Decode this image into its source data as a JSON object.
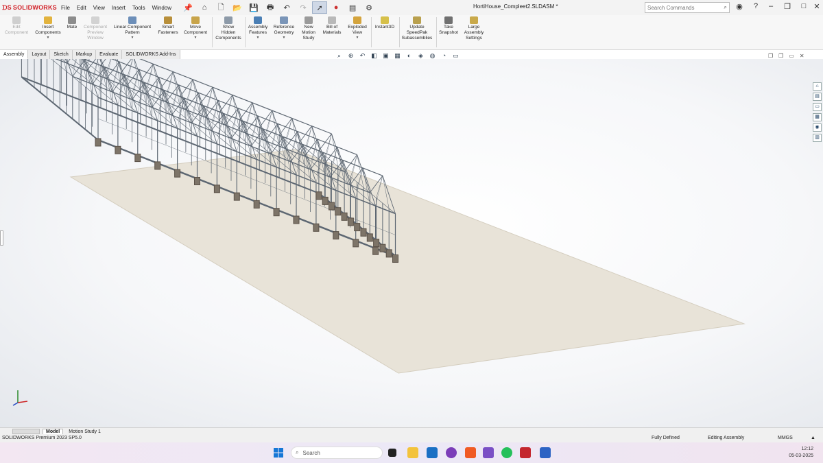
{
  "app": {
    "logo_text": "SOLIDWORKS",
    "document_title": "HortiHouse_Compleet2.SLDASM *",
    "colors": {
      "brand_red": "#d2232a",
      "viewport_bg": "#f6f7f9",
      "steel": "#55606b"
    }
  },
  "menu": [
    "File",
    "Edit",
    "View",
    "Insert",
    "Tools",
    "Window"
  ],
  "quick_access": [
    {
      "icon": "pin-icon"
    },
    {
      "icon": "home-icon"
    },
    {
      "icon": "new-document-icon"
    },
    {
      "icon": "open-icon"
    },
    {
      "icon": "save-icon"
    },
    {
      "icon": "print-icon"
    },
    {
      "icon": "undo-icon"
    },
    {
      "icon": "redo-icon"
    },
    {
      "icon": "select-cursor-icon"
    },
    {
      "icon": "rebuild-icon"
    },
    {
      "icon": "file-properties-icon"
    },
    {
      "icon": "options-gear-icon"
    }
  ],
  "search": {
    "placeholder": "Search Commands"
  },
  "ribbon": [
    {
      "label": "Edit\nComponent",
      "enabled": false,
      "icon": "edit-component-icon"
    },
    {
      "label": "Insert\nComponents",
      "enabled": true,
      "icon": "insert-components-icon"
    },
    {
      "label": "Mate",
      "enabled": true,
      "icon": "mate-icon"
    },
    {
      "label": "Component\nPreview\nWindow",
      "enabled": false,
      "icon": "component-preview-icon"
    },
    {
      "label": "Linear Component\nPattern",
      "enabled": true,
      "icon": "linear-pattern-icon"
    },
    {
      "label": "Smart\nFasteners",
      "enabled": true,
      "icon": "smart-fasteners-icon"
    },
    {
      "label": "Move\nComponent",
      "enabled": true,
      "icon": "move-component-icon"
    },
    {
      "label": "Show\nHidden\nComponents",
      "enabled": true,
      "icon": "show-hidden-icon"
    },
    {
      "label": "Assembly\nFeatures",
      "enabled": true,
      "icon": "assembly-features-icon"
    },
    {
      "label": "Reference\nGeometry",
      "enabled": true,
      "icon": "reference-geometry-icon"
    },
    {
      "label": "New\nMotion\nStudy",
      "enabled": true,
      "icon": "motion-study-icon"
    },
    {
      "label": "Bill of\nMaterials",
      "enabled": true,
      "icon": "bill-of-materials-icon"
    },
    {
      "label": "Exploded\nView",
      "enabled": true,
      "icon": "exploded-view-icon"
    },
    {
      "label": "Instant3D",
      "enabled": true,
      "icon": "instant3d-icon"
    },
    {
      "label": "Update\nSpeedPak\nSubassemblies",
      "enabled": true,
      "icon": "speedpak-icon"
    },
    {
      "label": "Take\nSnapshot",
      "enabled": true,
      "icon": "snapshot-icon"
    },
    {
      "label": "Large\nAssembly\nSettings",
      "enabled": true,
      "icon": "large-assembly-icon"
    }
  ],
  "tabs": [
    "Assembly",
    "Layout",
    "Sketch",
    "Markup",
    "Evaluate",
    "SOLIDWORKS Add-Ins"
  ],
  "bottom_tabs": [
    "Model",
    "Motion Study 1"
  ],
  "status": {
    "product": "SOLIDWORKS Premium 2023 SP5.0",
    "definition": "Fully Defined",
    "mode": "Editing Assembly",
    "units": "MMGS"
  },
  "taskbar": {
    "search": "Search",
    "time": "12:12",
    "date": "05-03-2025"
  }
}
